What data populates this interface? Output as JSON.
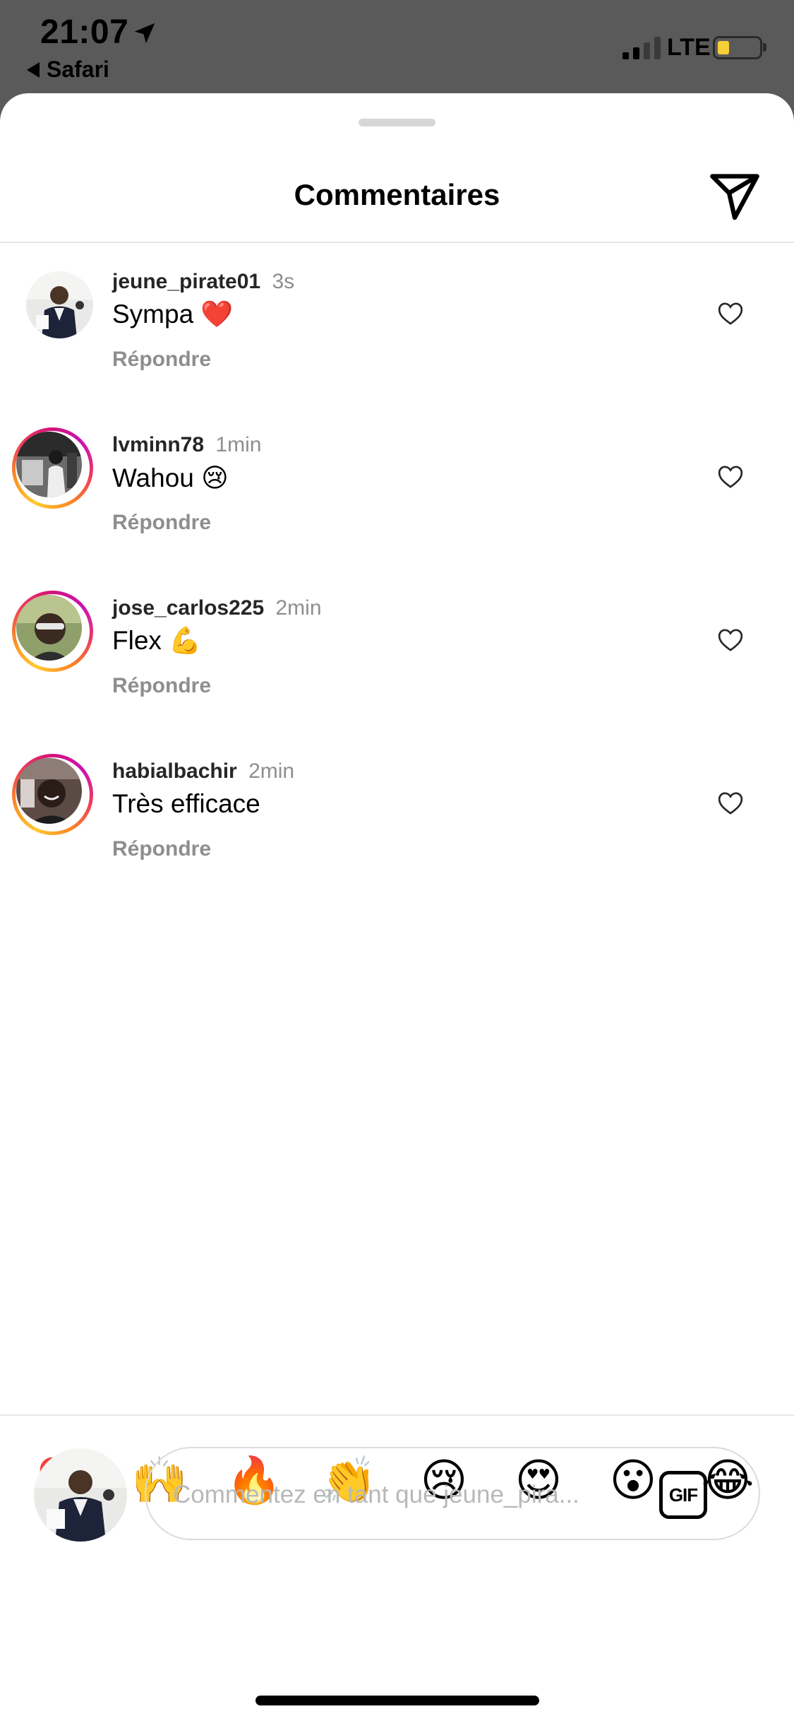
{
  "status_bar": {
    "time": "21:07",
    "back_app": "Safari",
    "network": "LTE",
    "battery_color": "#f5cf35"
  },
  "header": {
    "title": "Commentaires",
    "send_icon": "send-paper-plane-icon"
  },
  "comments": [
    {
      "username": "jeune_pirate01",
      "time": "3s",
      "text": "Sympa ❤️",
      "reply": "Répondre",
      "has_story_ring": false
    },
    {
      "username": "lvminn78",
      "time": "1min",
      "text": "Wahou 😢",
      "reply": "Répondre",
      "has_story_ring": true
    },
    {
      "username": "jose_carlos225",
      "time": "2min",
      "text": "Flex 💪",
      "reply": "Répondre",
      "has_story_ring": true
    },
    {
      "username": "habialbachir",
      "time": "2min",
      "text": "Très efficace",
      "reply": "Répondre",
      "has_story_ring": true
    }
  ],
  "emoji_bar": [
    "❤️",
    "🙌",
    "🔥",
    "👏",
    "😢",
    "😍",
    "😮",
    "😂"
  ],
  "composer": {
    "placeholder": "Commentez en tant que jeune_pira...",
    "gif_label": "GIF"
  },
  "colors": {
    "story_ring": [
      "#d3127b",
      "#f03b5b",
      "#fa8b24",
      "#ffc933"
    ],
    "secondary_text": "#8e8e8e"
  }
}
